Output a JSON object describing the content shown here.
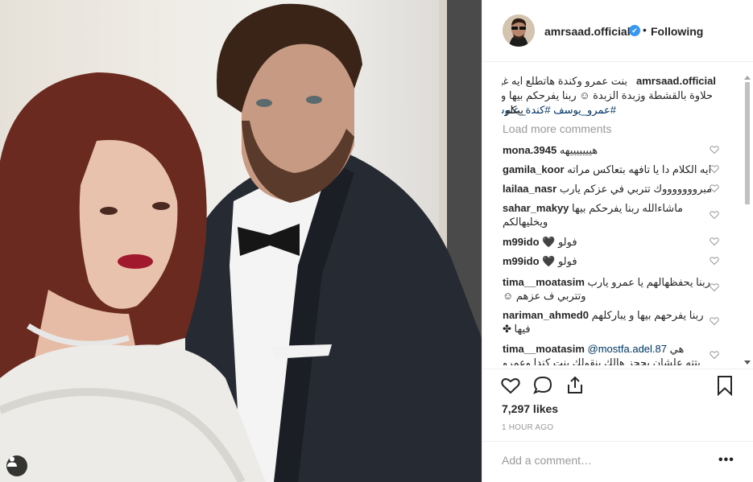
{
  "header": {
    "username": "amrsaad.official",
    "verified_mark": "✔",
    "separator": "•",
    "follow_status": "Following"
  },
  "caption": {
    "username": "amrsaad.official",
    "line1": "بنت عمرو وكندة هاتطلع ايه غير",
    "line2": "حلاوة بالقشطة وزبدة الزبدة ☺ ربنا يفرحكم بيها ويسعدها",
    "line3_prefix": "بيكم",
    "hashtags": "#عمرو_يوسف  #كندة_علوش"
  },
  "load_more": "Load more comments",
  "comments": [
    {
      "user": "mona.3945",
      "text": "هيييييييهه"
    },
    {
      "user": "gamila_koor",
      "text": "ايه الكلام دا يا تافهه بتعاكس مراته"
    },
    {
      "user": "lailaa_nasr",
      "text": "مبروووووووك تتربي في عزكم يارب"
    },
    {
      "user": "sahar_makyy",
      "text": "ماشاءالله ربنا يفرحكم بيها",
      "text2": "ويخليهالكم"
    },
    {
      "user": "m99ido",
      "text": "فولو 🖤"
    },
    {
      "user": "m99ido",
      "text": "فولو 🖤"
    },
    {
      "user": "tima__moatasim",
      "text": "ربنا يحفظهالهم يا عمرو يارب",
      "text2": "وتتربي ف عزهم ☺"
    },
    {
      "user": "nariman_ahmed0",
      "text": "ربنا يفرحهم بيها و يباركلهم",
      "text2": "فيها ✤"
    },
    {
      "user": "tima__moatasim",
      "mention": "@mostfa.adel.87",
      "text": "هي",
      "text2": "بتته علشان يحجز هالك بنقولك بنت كندا وعمرو"
    }
  ],
  "likes": "7,297 likes",
  "time": "1 HOUR AGO",
  "add_comment_placeholder": "Add a comment…",
  "more_options": "•••",
  "colors": {
    "link": "#003569",
    "verified": "#3897f0",
    "muted": "#999999",
    "text": "#262626"
  },
  "icons": [
    "heart-icon",
    "comment-icon",
    "share-icon",
    "bookmark-icon",
    "user-tag-icon"
  ]
}
